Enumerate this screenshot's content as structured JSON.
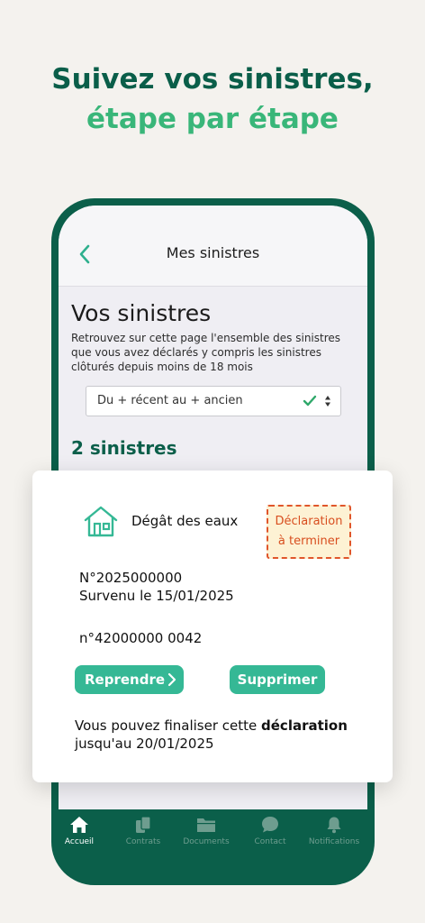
{
  "headline": {
    "line1": "Suivez vos sinistres,",
    "line2": "étape par étape"
  },
  "nav": {
    "title": "Mes sinistres",
    "back_icon": "chevron-left-icon"
  },
  "page": {
    "title": "Vos sinistres",
    "description": "Retrouvez sur cette page l'ensemble des sinistres que vous avez déclarés y compris les sinistres clôturés depuis moins de 18 mois",
    "sort_value": "Du + récent au + ancien",
    "count": "2 sinistres"
  },
  "card": {
    "icon": "house-icon",
    "type": "Dégât des eaux",
    "badge_line1": "Déclaration",
    "badge_line2": "à terminer",
    "number": "N°2025000000",
    "occurred": "Survenu le 15/01/2025",
    "contract": "n°42000000 0042",
    "resume_label": "Reprendre",
    "delete_label": "Supprimer",
    "message_start": "Vous pouvez finaliser cette ",
    "message_strong": "déclaration",
    "message_end": "jusqu'au 20/01/2025"
  },
  "tabs": [
    {
      "label": "Accueil",
      "icon": "home-icon",
      "active": true
    },
    {
      "label": "Contrats",
      "icon": "contracts-icon",
      "active": false
    },
    {
      "label": "Documents",
      "icon": "folder-icon",
      "active": false
    },
    {
      "label": "Contact",
      "icon": "chat-icon",
      "active": false
    },
    {
      "label": "Notifications",
      "icon": "bell-icon",
      "active": false
    }
  ],
  "colors": {
    "brand_dark": "#0b5f4a",
    "brand_light": "#39b679",
    "button": "#35b895",
    "badge_border": "#e0562b",
    "badge_bg": "#fdf2d4"
  }
}
